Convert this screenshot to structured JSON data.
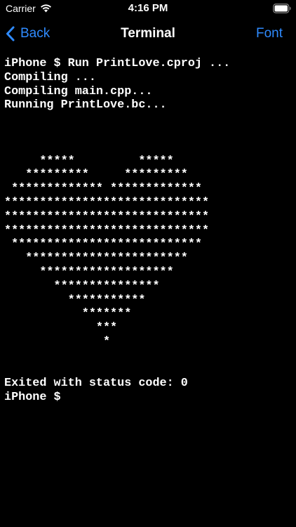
{
  "status_bar": {
    "carrier": "Carrier",
    "time": "4:16 PM",
    "wifi_icon": "wifi-icon",
    "battery_icon": "battery-icon"
  },
  "nav": {
    "back_label": "Back",
    "back_icon": "chevron-left-icon",
    "title": "Terminal",
    "font_label": "Font",
    "accent_color": "#2f8bff"
  },
  "terminal": {
    "background": "#000000",
    "text_color": "#ffffff",
    "lines": [
      "iPhone $ Run PrintLove.cproj ...",
      "Compiling ...",
      "Compiling main.cpp...",
      "Running PrintLove.bc...",
      "",
      "",
      "",
      "     *****         *****",
      "   *********     *********",
      " ************* *************",
      "*****************************",
      "*****************************",
      "*****************************",
      " ***************************",
      "   ***********************",
      "     *******************",
      "       ***************",
      "         ***********",
      "           *******",
      "             ***",
      "              *",
      "",
      "",
      "Exited with status code: 0",
      "iPhone $ "
    ]
  }
}
